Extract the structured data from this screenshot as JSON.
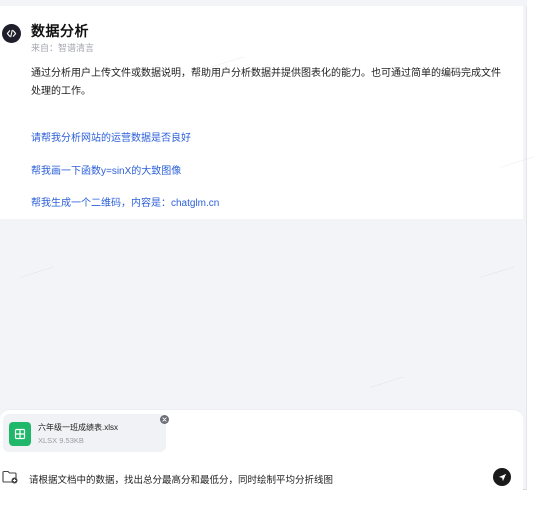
{
  "agent": {
    "title": "数据分析",
    "source": "来自：智谱清言",
    "description": "通过分析用户上传文件或数据说明，帮助用户分析数据并提供图表化的能力。也可通过简单的编码完成文件处理的工作。"
  },
  "suggestions": [
    "请帮我分析网站的运营数据是否良好",
    "帮我画一下函数y=sinX的大致图像",
    "帮我生成一个二维码，内容是：chatglm.cn"
  ],
  "attachment": {
    "name": "六年级一班成绩表.xlsx",
    "meta": "XLSX 9.53KB",
    "icon": "spreadsheet-icon",
    "color": "#1fb86a"
  },
  "input": {
    "value": "请根据文档中的数据，找出总分最高分和最低分，同时绘制平均分折线图"
  },
  "icons": {
    "logo": "code-icon",
    "attach": "folder-upload-icon",
    "send": "send-icon",
    "remove": "close-icon"
  }
}
